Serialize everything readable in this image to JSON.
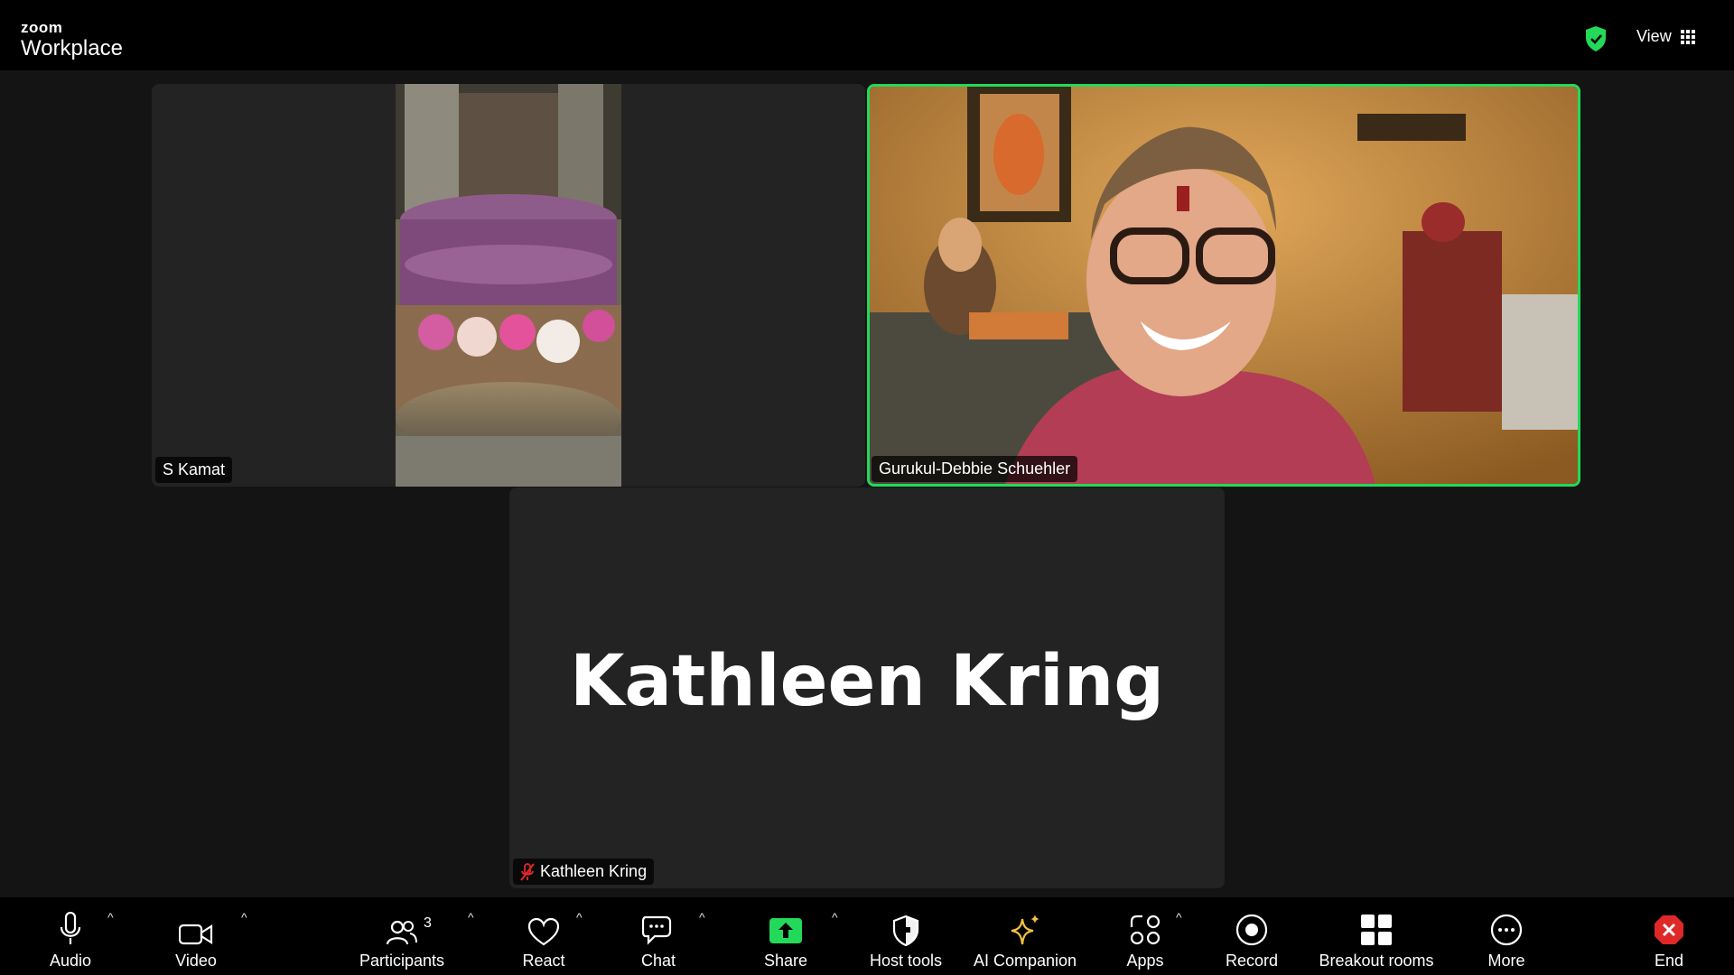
{
  "app": {
    "logo_small": "zoom",
    "logo_big": "Workplace",
    "view_label": "View"
  },
  "participants": {
    "s_kamat": "S Kamat",
    "debbie": "Gurukul-Debbie Schuehler",
    "kathleen": "Kathleen Kring",
    "kathleen_big": "Kathleen Kring"
  },
  "toolbar": {
    "audio": "Audio",
    "video": "Video",
    "participants": "Participants",
    "participants_count": "3",
    "react": "React",
    "chat": "Chat",
    "share": "Share",
    "host_tools": "Host tools",
    "ai_companion": "AI Companion",
    "apps": "Apps",
    "record": "Record",
    "breakout": "Breakout rooms",
    "more": "More",
    "end": "End"
  },
  "colors": {
    "active_speaker": "#23d959",
    "share_green": "#23d959",
    "end_red": "#e02828",
    "ai_yellow": "#f5c242"
  }
}
